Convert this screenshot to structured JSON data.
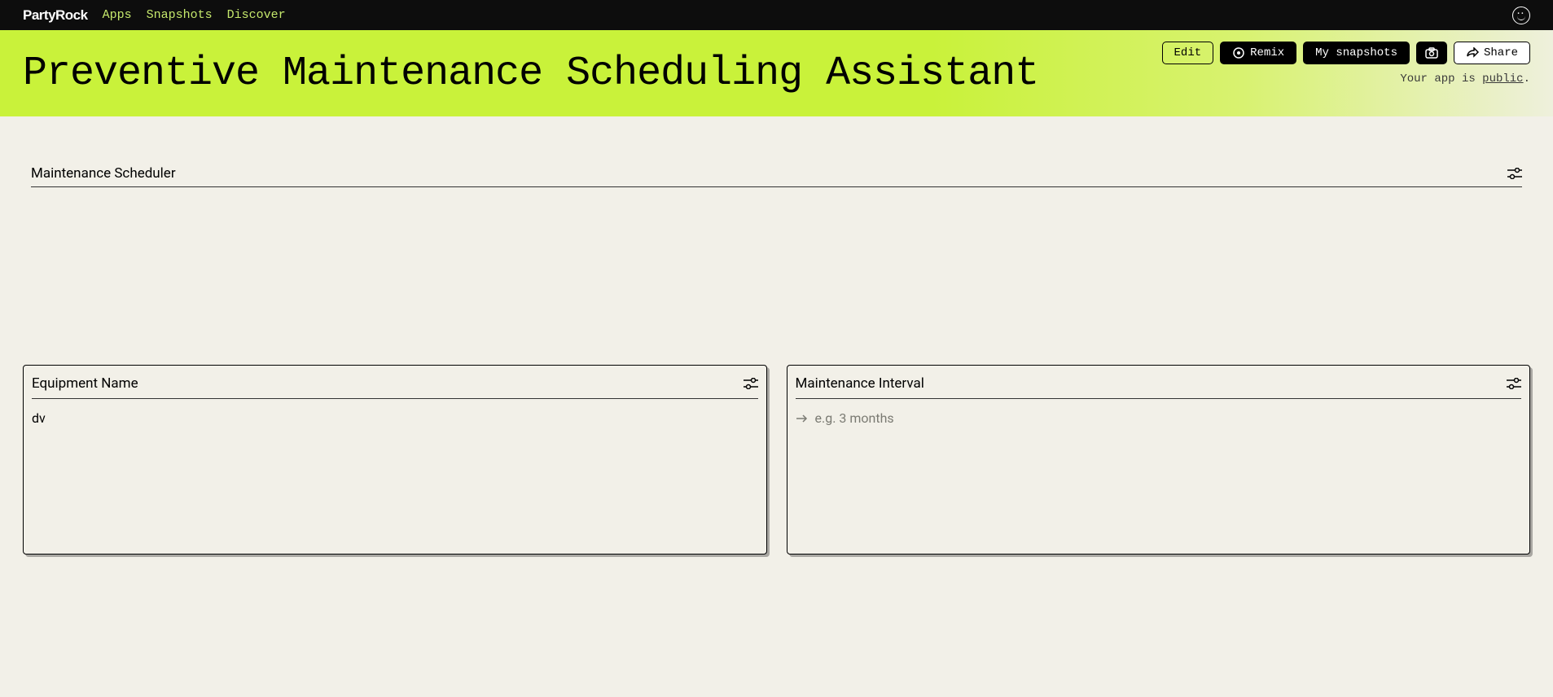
{
  "nav": {
    "logo": "PartyRock",
    "links": [
      "Apps",
      "Snapshots",
      "Discover"
    ]
  },
  "hero": {
    "title": "Preventive Maintenance Scheduling Assistant",
    "buttons": {
      "edit": "Edit",
      "remix": "Remix",
      "snapshots": "My snapshots",
      "share": "Share"
    },
    "visibility_prefix": "Your app is ",
    "visibility_link": "public",
    "visibility_suffix": "."
  },
  "scheduler": {
    "title": "Maintenance Scheduler"
  },
  "cards": {
    "equipment": {
      "title": "Equipment Name",
      "value": "dv"
    },
    "interval": {
      "title": "Maintenance Interval",
      "placeholder": "e.g. 3 months"
    }
  }
}
